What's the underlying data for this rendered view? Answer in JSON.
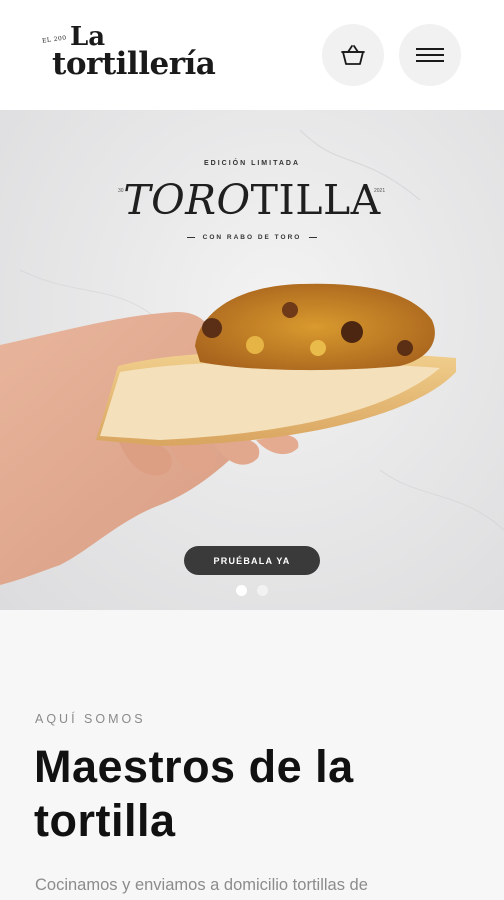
{
  "header": {
    "logo": {
      "since": "EL 200",
      "la": "La",
      "name": "tortillería"
    },
    "cart_icon": "basket-icon",
    "menu_icon": "hamburger-menu-icon"
  },
  "hero": {
    "edition": "EDICIÓN LIMITADA",
    "title_part1": "TORO",
    "title_part2": "TILLA",
    "mark_left": "30",
    "mark_right": "2021",
    "subtitle": "CON RABO DE TORO",
    "cta_label": "PRUÉBALA YA",
    "slides_total": 2,
    "active_slide": 1
  },
  "intro": {
    "eyebrow": "AQUÍ SOMOS",
    "headline": "Maestros de la tortilla",
    "body": "Cocinamos y enviamos a domicilio tortillas de"
  },
  "colors": {
    "cta_bg": "#3a3a3a",
    "intro_bg": "#f7f7f7",
    "header_btn_bg": "#f1f1f1"
  }
}
